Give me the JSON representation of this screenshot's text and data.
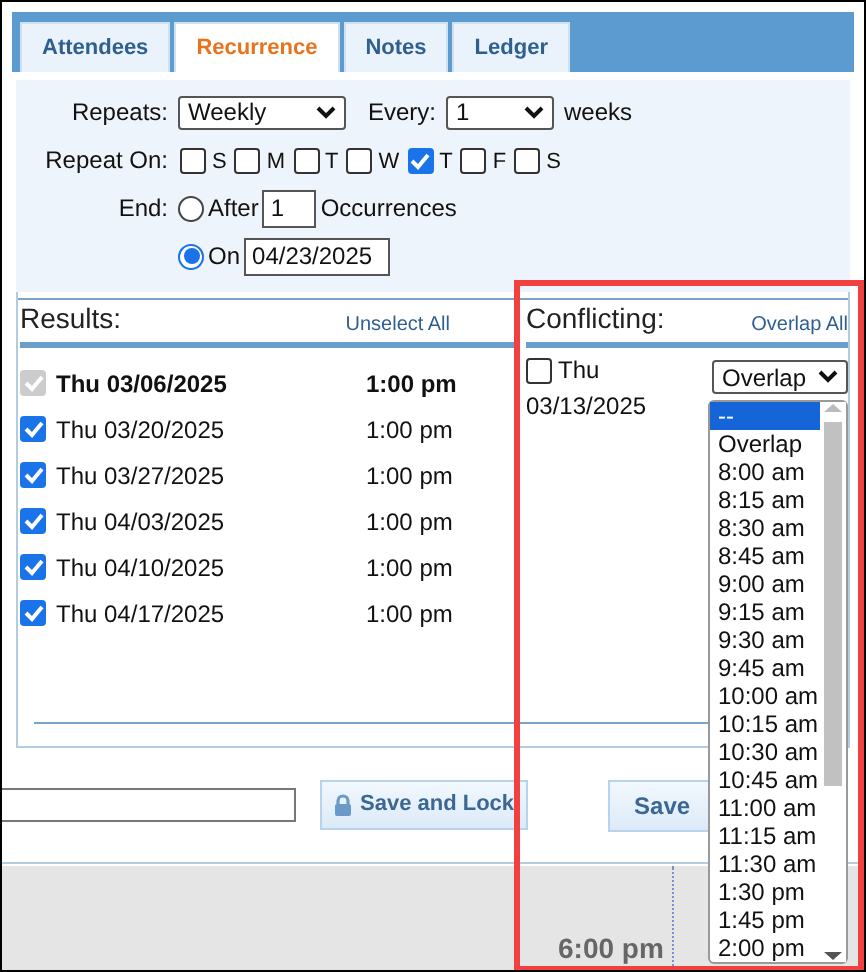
{
  "tabs": [
    {
      "label": "Attendees",
      "selected": false
    },
    {
      "label": "Recurrence",
      "selected": true
    },
    {
      "label": "Notes",
      "selected": false
    },
    {
      "label": "Ledger",
      "selected": false
    }
  ],
  "repeats": {
    "label": "Repeats:",
    "value": "Weekly"
  },
  "every": {
    "label": "Every:",
    "value": "1",
    "unit": "weeks"
  },
  "repeat_on": {
    "label": "Repeat On:",
    "days": [
      {
        "label": "S",
        "checked": false
      },
      {
        "label": "M",
        "checked": false
      },
      {
        "label": "T",
        "checked": false
      },
      {
        "label": "W",
        "checked": false
      },
      {
        "label": "T",
        "checked": true
      },
      {
        "label": "F",
        "checked": false
      },
      {
        "label": "S",
        "checked": false
      }
    ]
  },
  "end": {
    "label": "End:",
    "options": [
      {
        "kind": "after",
        "label": "After",
        "value": "1",
        "suffix": "Occurrences",
        "selected": false
      },
      {
        "kind": "on",
        "label": "On",
        "value": "04/23/2025",
        "selected": true
      }
    ]
  },
  "results": {
    "title": "Results:",
    "action": "Unselect All",
    "rows": [
      {
        "date": "Thu 03/06/2025",
        "time": "1:00 pm",
        "checked": true,
        "disabled": true
      },
      {
        "date": "Thu 03/20/2025",
        "time": "1:00 pm",
        "checked": true,
        "disabled": false
      },
      {
        "date": "Thu 03/27/2025",
        "time": "1:00 pm",
        "checked": true,
        "disabled": false
      },
      {
        "date": "Thu 04/03/2025",
        "time": "1:00 pm",
        "checked": true,
        "disabled": false
      },
      {
        "date": "Thu 04/10/2025",
        "time": "1:00 pm",
        "checked": true,
        "disabled": false
      },
      {
        "date": "Thu 04/17/2025",
        "time": "1:00 pm",
        "checked": true,
        "disabled": false
      }
    ]
  },
  "conflicting": {
    "title": "Conflicting:",
    "action": "Overlap All",
    "rows": [
      {
        "day": "Thu",
        "date": "03/13/2025",
        "checked": false,
        "select": {
          "value": "Overlap",
          "expanded": true,
          "options": [
            {
              "label": "--",
              "highlighted": true
            },
            {
              "label": "Overlap",
              "highlighted": false
            },
            {
              "label": "8:00 am",
              "highlighted": false
            },
            {
              "label": "8:15 am",
              "highlighted": false
            },
            {
              "label": "8:30 am",
              "highlighted": false
            },
            {
              "label": "8:45 am",
              "highlighted": false
            },
            {
              "label": "9:00 am",
              "highlighted": false
            },
            {
              "label": "9:15 am",
              "highlighted": false
            },
            {
              "label": "9:30 am",
              "highlighted": false
            },
            {
              "label": "9:45 am",
              "highlighted": false
            },
            {
              "label": "10:00 am",
              "highlighted": false
            },
            {
              "label": "10:15 am",
              "highlighted": false
            },
            {
              "label": "10:30 am",
              "highlighted": false
            },
            {
              "label": "10:45 am",
              "highlighted": false
            },
            {
              "label": "11:00 am",
              "highlighted": false
            },
            {
              "label": "11:15 am",
              "highlighted": false
            },
            {
              "label": "11:30 am",
              "highlighted": false
            },
            {
              "label": "1:30 pm",
              "highlighted": false
            },
            {
              "label": "1:45 pm",
              "highlighted": false
            },
            {
              "label": "2:00 pm",
              "highlighted": false
            }
          ]
        }
      }
    ]
  },
  "footer": {
    "buttons": [
      {
        "label": "Save and Lock",
        "kind": "lock"
      },
      {
        "label": "Save",
        "kind": "plain"
      }
    ]
  },
  "calendar": {
    "times": [
      "6:00 pm"
    ]
  }
}
